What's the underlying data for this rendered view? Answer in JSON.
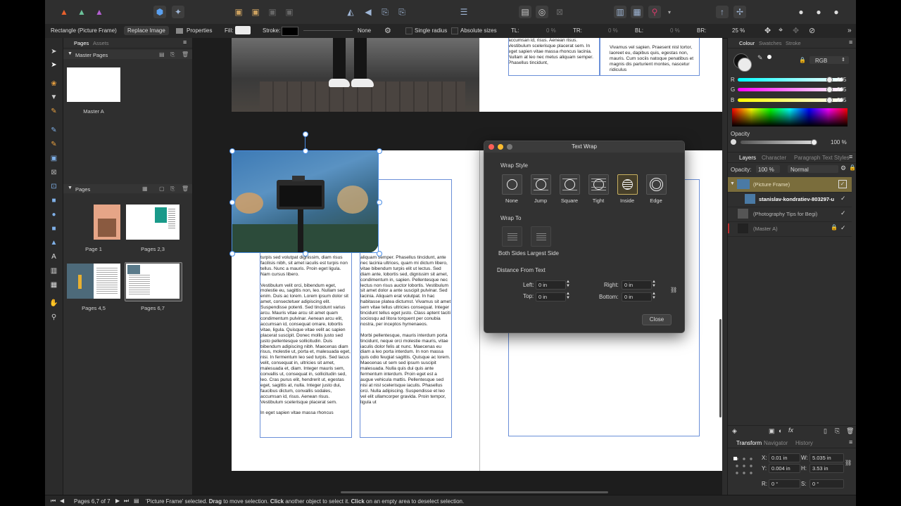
{
  "context_toolbar": {
    "selection_label": "Rectangle (Picture Frame)",
    "replace_image": "Replace Image",
    "properties": "Properties",
    "fill_label": "Fill:",
    "stroke_label": "Stroke:",
    "stroke_value": "None",
    "single_radius": "Single radius",
    "absolute_sizes": "Absolute sizes",
    "tl_label": "TL:",
    "tl_value": "0 %",
    "tr_label": "TR:",
    "tr_value": "0 %",
    "bl_label": "BL:",
    "bl_value": "0 %",
    "br_label": "BR:",
    "zoom": "25 %"
  },
  "pages_panel": {
    "tab_pages": "Pages",
    "tab_assets": "Assets",
    "master_pages_header": "Master Pages",
    "master_a": "Master A",
    "pages_header": "Pages",
    "page_labels": [
      "Page 1",
      "Pages 2,3",
      "Pages 4,5",
      "Pages 6,7"
    ]
  },
  "canvas": {
    "top_right_col1": "accumsan id, risus. Aenean risus. Vestibulum scelerisque placerat sem.\n\nIn eget sapien vitae massa rhoncus lacinia. Nullam at leo nec metus aliquam semper. Phasellus tincidunt,",
    "top_right_col2": "Vivamus vel sapien. Praesent nisl tortor, laoreet eu, dapibus quis, egestas non, mauris. Cum sociis natoque penatibus et magnis dis parturient montes, nascetur ridiculus",
    "left_col": "turpis sed volutpat dignissim, diam risus facilisis nibh, sit amet iaculis est turpis non tellus. Nunc a mauris. Proin eget ligula. Nam cursus libero.\n\nVestibulum velit orci, bibendum eget, molestie eu, sagittis non, leo. Nullam sed enim. Duis ac lorem. Lorem ipsum dolor sit amet, consectetuer adipiscing elit. Suspendisse potenti. Sed tincidunt varius arcu. Mauris vitae arcu sit amet quam condimentum pulvinar. Aenean arcu elit, accumsan id, consequat ornare, lobortis vitae, ligula. Quisque vitae velit ac sapien placerat suscipit. Donec mollis justo sed justo pellentesque sollicitudin. Duis bibendum adipiscing nibh. Maecenas diam risus, molestie ut, porta et, malesuada eget, nisi. In fermentum leo sed turpis. Sed lacus velit, consequat in, ultricies sit amet, malesuada et, diam. Integer mauris sem, convallis ut, consequat in, sollicitudin sed, leo. Cras purus elit, hendrerit ut, egestas eget, sagittis at, nulla. Integer justo dui, faucibus dictum, convallis sodales, accumsan id, risus. Aenean risus. Vestibulum scelerisque placerat sem.\n\nIn eget sapien vitae massa rhoncus",
    "right_col": "aliquam semper. Phasellus tincidunt, ante nec lacinia ultrices, quam mi dictum libero, vitae bibendum turpis elit ut lectus. Sed diam ante, lobortis sed, dignissim sit amet, condimentum in, sapien. Pellentesque nec lectus non risus auctor lobortis. Vestibulum sit amet dolor a ante suscipit pulvinar. Sed lacinia. Aliquam erat volutpat. In hac habitasse platea dictumst. Vivamus sit amet sem vitae tellus ultricies consequat. Integer tincidunt tellus eget justo. Class aptent taciti sociosqu ad litora torquent per conubia nostra, per inceptos hymenaeos.\n\nMorbi pellentesque, mauris interdum porta tincidunt, neque orci molestie mauris, vitae iaculis dolor felis at nunc. Maecenas eu diam a leo porta interdum. In non massa quis odio feugiat sagittis. Quisque ac lorem. Maecenas ut sem sed ipsum suscipit malesuada. Nulla quis dui quis ante fermentum interdum. Proin eget est a augue vehicula mattis. Pellentesque sed nisi at nisl scelerisque iaculis. Phasellus orci. Nulla adipiscing. Suspendisse et leo vel elit ullamcorper gravida. Proin tempor, ligula ut"
  },
  "dialog": {
    "title": "Text Wrap",
    "wrap_style_label": "Wrap Style",
    "styles": [
      "None",
      "Jump",
      "Square",
      "Tight",
      "Inside",
      "Edge"
    ],
    "wrap_to_label": "Wrap To",
    "wrap_to": [
      "Both Sides",
      "Largest Side"
    ],
    "distance_label": "Distance From Text",
    "left_label": "Left:",
    "left_value": "0 in",
    "right_label": "Right:",
    "right_value": "0 in",
    "top_label": "Top:",
    "top_value": "0 in",
    "bottom_label": "Bottom:",
    "bottom_value": "0 in",
    "close": "Close"
  },
  "colour_panel": {
    "tabs": [
      "Colour",
      "Swatches",
      "Stroke"
    ],
    "model": "RGB",
    "r_label": "R",
    "r_value": "235",
    "g_label": "G",
    "g_value": "235",
    "b_label": "B",
    "b_value": "235",
    "opacity_label": "Opacity",
    "opacity_value": "100 %"
  },
  "layers_panel": {
    "tabs": [
      "Layers",
      "Character",
      "Paragraph",
      "Text Styles"
    ],
    "opacity_label": "Opacity:",
    "opacity_value": "100 %",
    "blend_mode": "Normal",
    "layers": [
      "(Picture Frame)",
      "stanislav-kondratiev-803297-u",
      "(Photography Tips for Begi)",
      "(Master A)"
    ]
  },
  "transform_panel": {
    "tabs": [
      "Transform",
      "Navigator",
      "History"
    ],
    "x_label": "X:",
    "x_value": "0.01 in",
    "y_label": "Y:",
    "y_value": "0.004 in",
    "w_label": "W:",
    "w_value": "5.035 in",
    "h_label": "H:",
    "h_value": "3.53 in",
    "r_label": "R:",
    "r_value": "0 °",
    "s_label": "S:",
    "s_value": "0 °"
  },
  "status_bar": {
    "page_indicator": "Pages 6,7 of 7",
    "message_1": "'Picture Frame' selected. ",
    "message_bold_1": "Drag",
    "message_2": " to move selection. ",
    "message_bold_2": "Click",
    "message_3": " another object to select it. ",
    "message_bold_3": "Click",
    "message_4": " on an empty area to deselect selection."
  },
  "colors": {
    "accent_blue": "#4a8ee6",
    "selected_layer": "#7a6d3c",
    "canvas_bg": "#1d1d1d"
  }
}
